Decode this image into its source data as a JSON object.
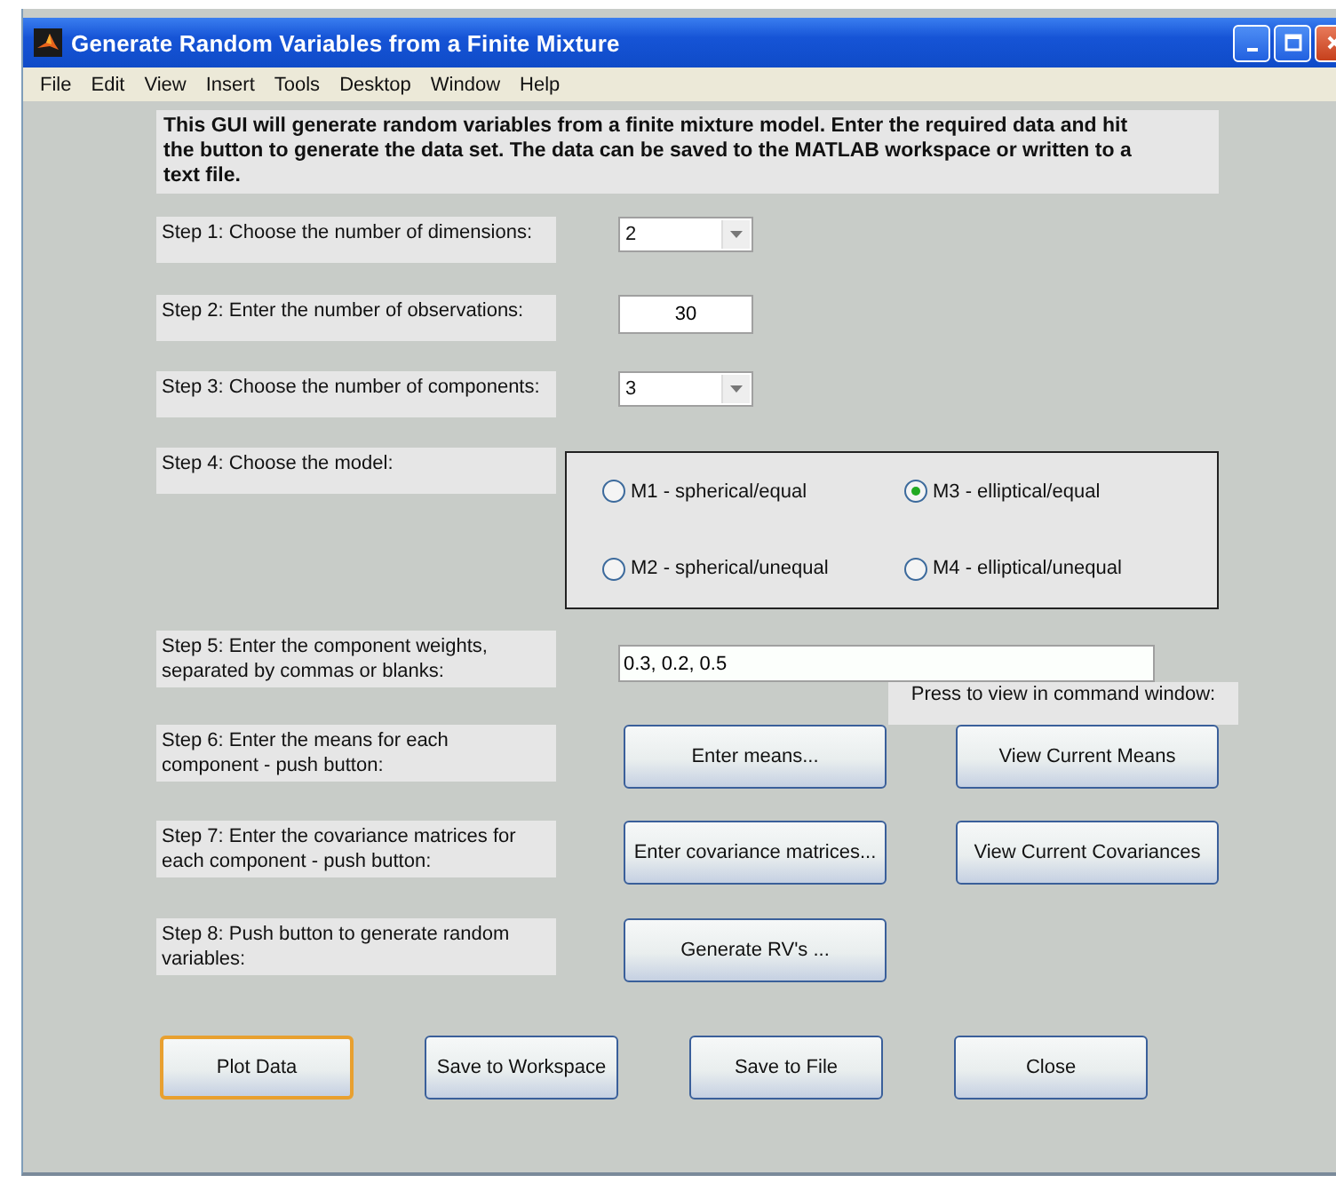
{
  "window": {
    "title": "Generate Random Variables from a Finite Mixture"
  },
  "menu": [
    "File",
    "Edit",
    "View",
    "Insert",
    "Tools",
    "Desktop",
    "Window",
    "Help"
  ],
  "intro": "This GUI will generate random variables from a finite mixture model.  Enter the required data and hit the button to generate the data set.  The data can be saved to the MATLAB workspace or written to a text file.",
  "steps": [
    {
      "kind": "dropdown",
      "label": "Step 1: Choose the number of dimensions:",
      "value": "2"
    },
    {
      "kind": "input",
      "label": "Step 2: Enter the number of observations:",
      "value": "30"
    },
    {
      "kind": "dropdown",
      "label": "Step 3: Choose the number of components:",
      "value": "3"
    },
    {
      "kind": "radios",
      "label": "Step 4: Choose the model:",
      "options": [
        {
          "label": "M1 - spherical/equal",
          "selected": false
        },
        {
          "label": "M3 - elliptical/equal",
          "selected": true
        },
        {
          "label": "M2 - spherical/unequal",
          "selected": false
        },
        {
          "label": "M4 - elliptical/unequal",
          "selected": false
        }
      ]
    },
    {
      "kind": "wide_input",
      "label": "Step 5: Enter the component weights, separated by commas or blanks:",
      "value": "0.3, 0.2, 0.5",
      "note": "Press to view in command window:"
    },
    {
      "kind": "buttons",
      "label": "Step 6: Enter the means for each component - push button:",
      "buttons": [
        "Enter means...",
        "View Current Means"
      ]
    },
    {
      "kind": "buttons",
      "label": "Step 7: Enter the covariance matrices for each component - push button:",
      "buttons": [
        "Enter covariance matrices...",
        "View Current Covariances"
      ]
    },
    {
      "kind": "buttons",
      "label": "Step 8: Push button to generate random variables:",
      "buttons": [
        "Generate RV's ..."
      ]
    }
  ],
  "bottom_buttons": [
    {
      "label": "Plot Data",
      "focused": true
    },
    {
      "label": "Save to Workspace",
      "focused": false
    },
    {
      "label": "Save to File",
      "focused": false
    },
    {
      "label": "Close",
      "focused": false
    }
  ]
}
